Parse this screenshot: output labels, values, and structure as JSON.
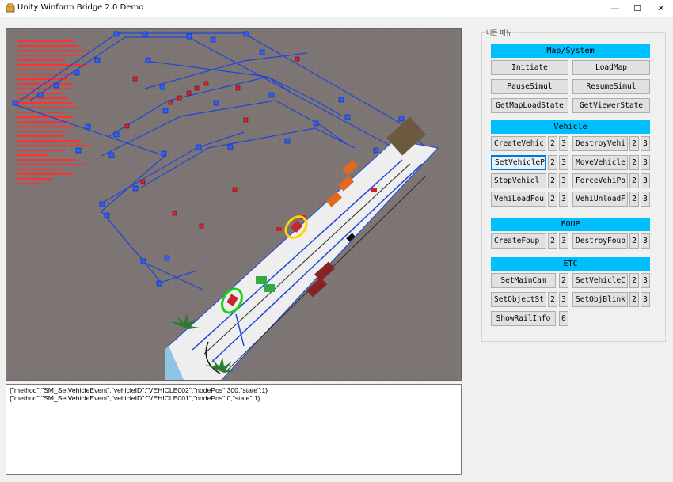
{
  "window": {
    "title": "Unity Winform Bridge 2.0 Demo",
    "minimize": "—",
    "maximize": "☐",
    "close": "✕"
  },
  "log": {
    "lines": [
      "{\"method\":\"SM_SetVehicleEvent\",\"vehicleID\":\"VEHICLE002\",\"nodePos\":300,\"state\":1}",
      "{\"method\":\"SM_SetVehicleEvent\",\"vehicleID\":\"VEHICLE001\",\"nodePos\":0,\"state\":1}"
    ]
  },
  "panel": {
    "group_title": "버튼 메뉴",
    "sections": {
      "map_system": "Map/System",
      "vehicle": "Vehicle",
      "foup": "FOUP",
      "etc": "ETC"
    },
    "buttons": {
      "initiate": "Initiate",
      "loadmap": "LoadMap",
      "pausesimul": "PauseSimul",
      "resumesimul": "ResumeSimul",
      "getmaploadstate": "GetMapLoadState",
      "getviewerstate": "GetViewerState",
      "createvehic": "CreateVehic",
      "destroyvehi": "DestroyVehi",
      "setvehiclep": "SetVehicleP",
      "movevehicle": "MoveVehicle",
      "stopvehicl": "StopVehicl",
      "forcevehipo": "ForceVehiPo",
      "vehiloadfou": "VehiLoadFou",
      "vehiunloadf": "VehiUnloadF",
      "createfoup": "CreateFoup",
      "destroyfoup": "DestroyFoup",
      "setmaincam": "SetMainCam",
      "setvehiclec": "SetVehicleC",
      "setobjectst": "SetObjectSt",
      "setobjblink": "SetObjBlink",
      "showrailinfo": "ShowRailInfo"
    },
    "n0": "0",
    "n2": "2",
    "n3": "3"
  },
  "colors": {
    "accent": "#00bfff",
    "viewport_bg": "#7d7474",
    "rail": "#1f46d6",
    "node_red": "#e0202a",
    "highlight_yellow": "#ffd400",
    "highlight_green": "#19d219"
  }
}
